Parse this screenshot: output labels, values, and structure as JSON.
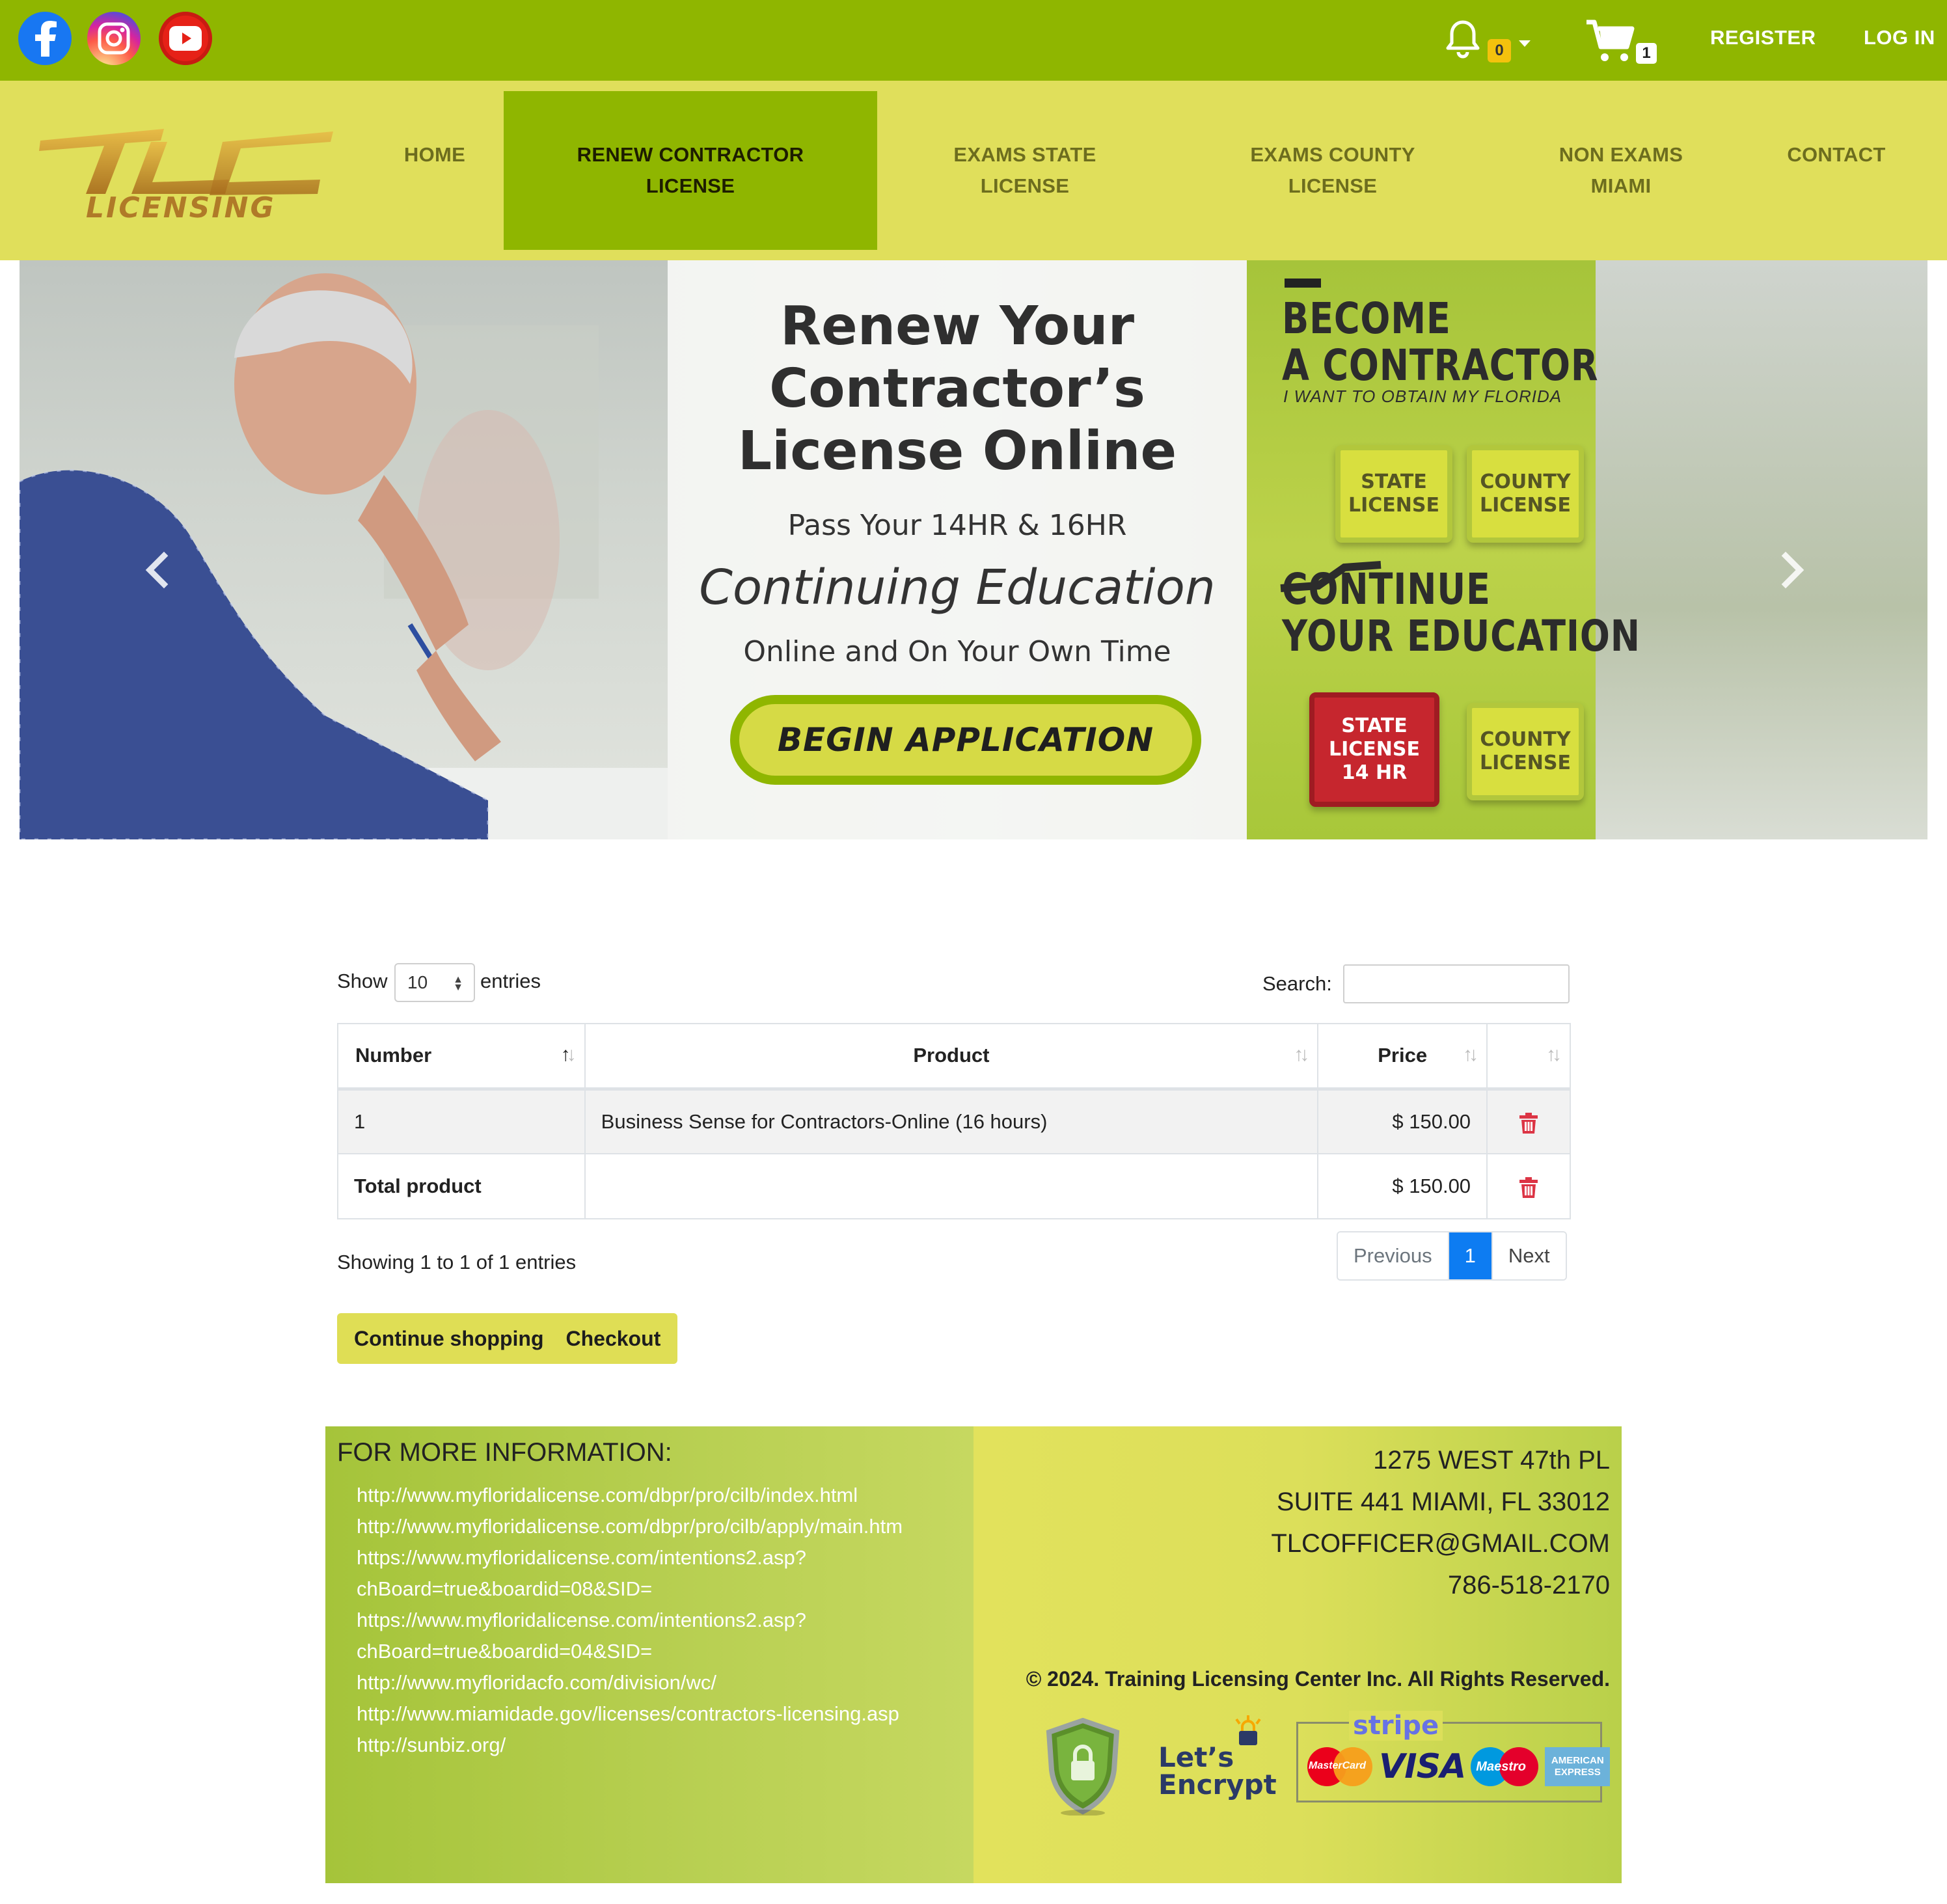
{
  "topbar": {
    "social": [
      "facebook",
      "instagram",
      "youtube"
    ],
    "notifications_count": "0",
    "cart_count": "1",
    "register_label": "REGISTER",
    "login_label": "LOG IN",
    "background": "#8fb600"
  },
  "nav": {
    "logo_text": "LICENSING",
    "logo_mark": "TLC",
    "items": [
      {
        "line1": "HOME",
        "line2": ""
      },
      {
        "line1": "RENEW CONTRACTOR",
        "line2": "LICENSE",
        "active": true
      },
      {
        "line1": "EXAMS STATE",
        "line2": "LICENSE"
      },
      {
        "line1": "EXAMS COUNTY",
        "line2": "LICENSE"
      },
      {
        "line1": "NON EXAMS",
        "line2": "MIAMI"
      },
      {
        "line1": "CONTACT",
        "line2": ""
      }
    ],
    "background": "#e0df5b",
    "active_background": "#8fb600"
  },
  "hero": {
    "title_line1": "Renew Your",
    "title_line2": "Contractor’s",
    "title_line3": "License Online",
    "sub1": "Pass Your 14HR & 16HR",
    "sub2": "Continuing Education",
    "sub3": "Online and On Your Own Time",
    "cta": "BEGIN APPLICATION",
    "panel": {
      "become_line1": "BECOME",
      "become_line2": "A CONTRACTOR",
      "want_text": "I WANT TO OBTAIN MY FLORIDA",
      "box1_line1": "STATE",
      "box1_line2": "LICENSE",
      "box2_line1": "COUNTY",
      "box2_line2": "LICENSE",
      "continue_line1": "CONTINUE",
      "continue_line2": "YOUR EDUCATION",
      "box3_line1": "STATE",
      "box3_line2": "LICENSE",
      "box3_line3": "14 HR",
      "box4_line1": "COUNTY",
      "box4_line2": "LICENSE"
    }
  },
  "table_controls": {
    "show_label": "Show",
    "page_length": "10",
    "entries_label": "entries",
    "search_label": "Search:",
    "search_value": ""
  },
  "table": {
    "headers": {
      "number": "Number",
      "product": "Product",
      "price": "Price"
    },
    "rows": [
      {
        "number": "1",
        "product": "Business Sense for Contractors-Online (16 hours)",
        "price": "$ 150.00"
      }
    ],
    "total": {
      "label": "Total product",
      "price": "$ 150.00"
    }
  },
  "pagination": {
    "info": "Showing 1 to 1 of 1 entries",
    "previous": "Previous",
    "current": "1",
    "next": "Next"
  },
  "actions": {
    "continue_label": "Continue shopping",
    "checkout_label": "Checkout"
  },
  "footer": {
    "info_title": "FOR MORE INFORMATION:",
    "links": [
      "http://www.myfloridalicense.com/dbpr/pro/cilb/index.html",
      "http://www.myfloridalicense.com/dbpr/pro/cilb/apply/main.htm",
      "https://www.myfloridalicense.com/intentions2.asp?",
      "chBoard=true&boardid=08&SID=",
      "https://www.myfloridalicense.com/intentions2.asp?",
      "chBoard=true&boardid=04&SID=",
      "http://www.myfloridacfo.com/division/wc/",
      "http://www.miamidade.gov/licenses/contractors-licensing.asp",
      "http://sunbiz.org/"
    ],
    "address_line1": "1275 WEST 47th PL",
    "address_line2": "SUITE 441 MIAMI, FL 33012",
    "email": "TLCOFFICER@GMAIL.COM",
    "phone": "786-518-2170",
    "copyright": "© 2024. Training Licensing Center Inc. All Rights Reserved.",
    "le_line1": "Let’s",
    "le_line2": "Encrypt",
    "stripe": "stripe",
    "card_mc": "MasterCard",
    "card_visa": "VISA",
    "card_maestro": "Maestro",
    "card_amex_line1": "AMERICAN",
    "card_amex_line2": "EXPRESS"
  },
  "colors": {
    "accent_green": "#8fb600",
    "accent_yellow": "#e0df5b",
    "page_active_blue": "#0d7cf2",
    "delete_red": "#dc3545"
  }
}
